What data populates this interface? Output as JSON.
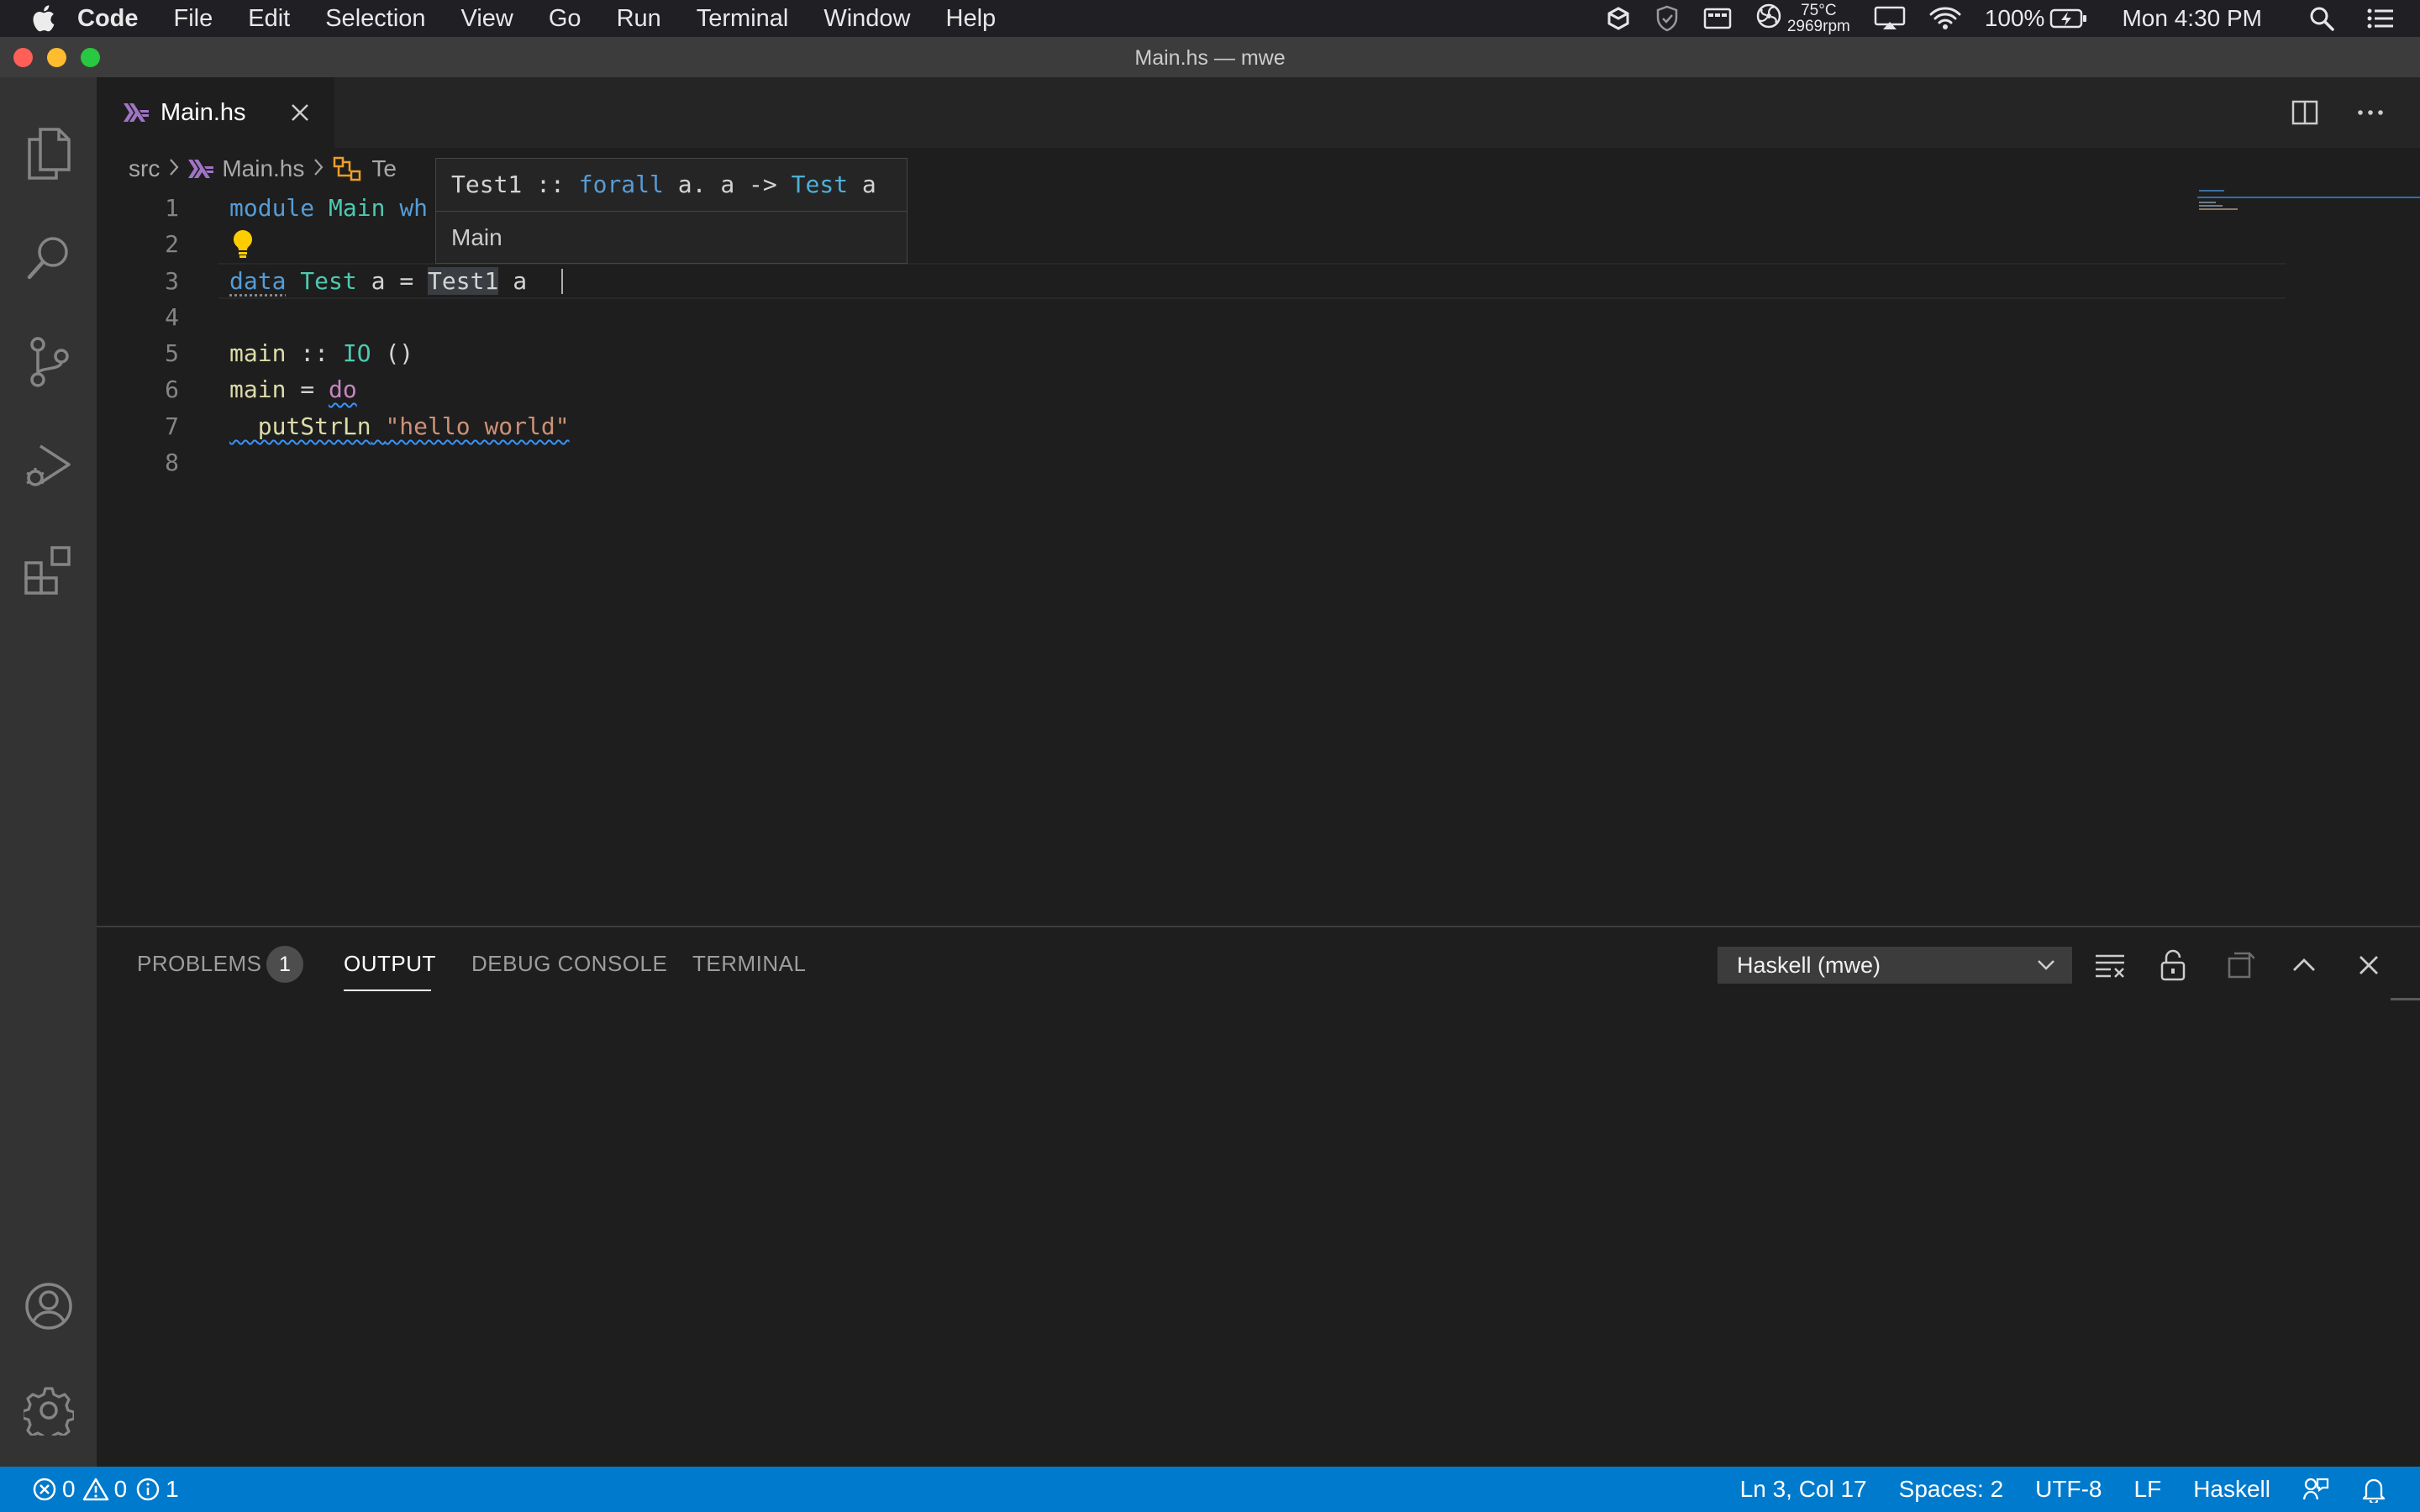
{
  "menubar": {
    "app_name": "Code",
    "items": [
      "File",
      "Edit",
      "Selection",
      "View",
      "Go",
      "Run",
      "Terminal",
      "Window",
      "Help"
    ],
    "temperature": "75°C",
    "fan_speed": "2969rpm",
    "battery": "100%",
    "clock": "Mon 4:30 PM"
  },
  "window": {
    "title": "Main.hs — mwe"
  },
  "activity_bar": {
    "icons": [
      "explorer-icon",
      "search-icon",
      "source-control-icon",
      "run-debug-icon",
      "extensions-icon",
      "accounts-icon",
      "settings-gear-icon"
    ]
  },
  "tab": {
    "label": "Main.hs"
  },
  "breadcrumb": {
    "folder": "src",
    "file": "Main.hs",
    "symbol": "Te"
  },
  "editor": {
    "line_numbers": [
      "1",
      "2",
      "3",
      "4",
      "5",
      "6",
      "7",
      "8"
    ],
    "line1": {
      "kw": "module",
      "mod": "Main",
      "rest": "wh"
    },
    "line3": {
      "kw": "data",
      "type": "Test",
      "var": "a",
      "eq": "=",
      "con": "Test1",
      "arg": "a"
    },
    "line5": {
      "fn": "main",
      "op": "::",
      "type": "IO",
      "unit": "()"
    },
    "line6": {
      "fn": "main",
      "eq": "=",
      "kw": "do"
    },
    "line7": {
      "fn": "putStrLn",
      "str": "\"hello world\""
    }
  },
  "hover": {
    "name": "Test1",
    "op": "::",
    "forall": "forall",
    "sig_rest": "a. a ->",
    "type": "Test",
    "var": "a",
    "module": "Main"
  },
  "panel": {
    "tabs": [
      "PROBLEMS",
      "OUTPUT",
      "DEBUG CONSOLE",
      "TERMINAL"
    ],
    "problems_count": "1",
    "active_tab": "OUTPUT",
    "channel": "Haskell (mwe)"
  },
  "statusbar": {
    "errors": "0",
    "warnings": "0",
    "infos": "1",
    "position": "Ln 3, Col 17",
    "spaces": "Spaces: 2",
    "encoding": "UTF-8",
    "eol": "LF",
    "language": "Haskell"
  },
  "colors": {
    "accent": "#007acc",
    "keyword": "#569cd6",
    "type": "#4ec9b0",
    "function": "#dcdcaa",
    "string": "#ce9178",
    "control": "#c586c0"
  }
}
